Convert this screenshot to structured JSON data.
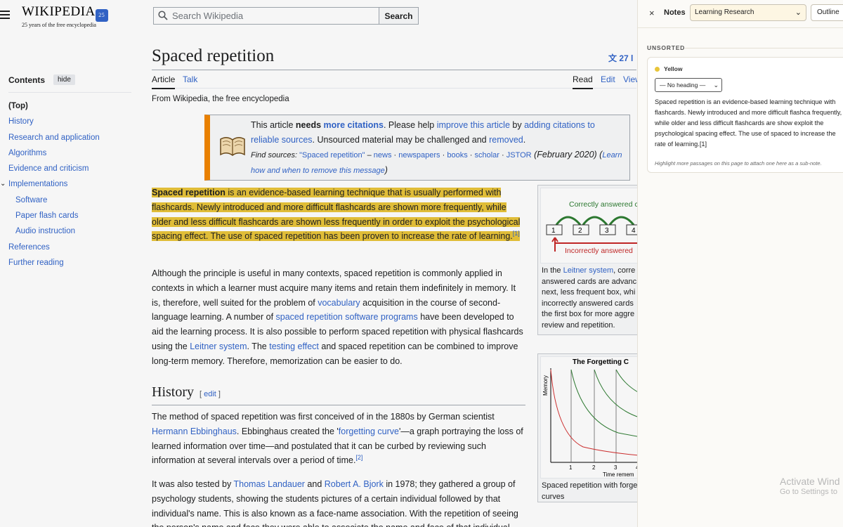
{
  "header": {
    "logo_text": "WIKIPEDIA",
    "logo_badge": "25",
    "tagline": "25 years of the free encyclopedia",
    "search_placeholder": "Search Wikipedia",
    "search_button": "Search"
  },
  "toc": {
    "title": "Contents",
    "hide": "hide",
    "items": [
      {
        "label": "(Top)"
      },
      {
        "label": "History"
      },
      {
        "label": "Research and application"
      },
      {
        "label": "Algorithms"
      },
      {
        "label": "Evidence and criticism"
      },
      {
        "label": "Implementations"
      },
      {
        "label": "Software"
      },
      {
        "label": "Paper flash cards"
      },
      {
        "label": "Audio instruction"
      },
      {
        "label": "References"
      },
      {
        "label": "Further reading"
      }
    ]
  },
  "article": {
    "title": "Spaced repetition",
    "languages": "27 l",
    "tab_article": "Article",
    "tab_talk": "Talk",
    "tab_read": "Read",
    "tab_edit": "Edit",
    "tab_view": "View",
    "from": "From Wikipedia, the free encyclopedia",
    "ambox": {
      "t1": "This article ",
      "t2": "needs ",
      "t3": "more citations",
      "t4": ". Please help ",
      "t5": "improve this article",
      "t6": " by ",
      "t7": "adding citations to reliable sources",
      "t8": ". Unsourced material may be challenged and ",
      "t9": "removed",
      "t10": ".",
      "find": "Find sources: ",
      "q": "\"Spaced repetition\"",
      "dash": " – ",
      "news": "news",
      "newspapers": "newspapers",
      "books": "books",
      "scholar": "scholar",
      "jstor": "JSTOR",
      "date": " (February 2020) (",
      "learn": "Learn how and when to remove this message",
      "close": ")"
    },
    "p1": {
      "b": "Spaced repetition",
      "t": " is an evidence-based learning technique that is usually performed with flashcards. Newly introduced and more difficult flashcards are shown more frequently, while older and less difficult flashcards are shown less frequently in order to exploit the psychological spacing effect. The use of spaced repetition has been proven to increase the rate of learning.",
      "ref": "[1]"
    },
    "p2": {
      "a": "Although the principle is useful in many contexts, spaced repetition is commonly applied in contexts in which a learner must acquire many items and retain them indefinitely in memory. It is, therefore, well suited for the problem of ",
      "l1": "vocabulary",
      "b": " acquisition in the course of second-language learning. A number of ",
      "l2": "spaced repetition software programs",
      "c": " have been developed to aid the learning process. It is also possible to perform spaced repetition with physical flashcards using the ",
      "l3": "Leitner system",
      "d": ". The ",
      "l4": "testing effect",
      "e": " and spaced repetition can be combined to improve long-term memory. Therefore, memorization can be easier to do."
    },
    "history": {
      "heading": "History",
      "edit": "edit",
      "lb": "[ ",
      "rb": " ]",
      "p1a": "The method of spaced repetition was first conceived of in the 1880s by German scientist ",
      "p1l1": "Hermann Ebbinghaus",
      "p1b": ". Ebbinghaus created the '",
      "p1l2": "forgetting curve",
      "p1c": "'—a graph portraying the loss of learned information over time—and postulated that it can be curbed by reviewing such information at several intervals over a period of time.",
      "p1ref": "[2]",
      "p2a": "It was also tested by ",
      "p2l1": "Thomas Landauer",
      "p2b": " and ",
      "p2l2": "Robert A. Bjork",
      "p2c": " in 1978; they gathered a group of psychology students, showing the students pictures of a certain individual followed by that individual's name. This is also known as a face-name association. With the repetition of seeing the person's name and face they were able to associate the name and face of that individual shown with the expan"
    },
    "leitner": {
      "top_label": "Correctly answered c",
      "bottom_label": "Incorrectly answered",
      "boxes": [
        "1",
        "2",
        "3",
        "4"
      ],
      "cap_a": "In the ",
      "cap_link": "Leitner system",
      "cap_b": ", corre answered cards are advanc next, less frequent box, whi incorrectly answered cards the first box for more aggre review and repetition."
    },
    "forgetting": {
      "title": "The Forgetting C",
      "ylabel": "Memory",
      "xlabel": "Time remem",
      "ticks": [
        "1",
        "2",
        "3",
        "4"
      ],
      "caption": "Spaced repetition with forge curves"
    }
  },
  "notes": {
    "close": "×",
    "title": "Notes",
    "collection": "Learning Research",
    "view_mode": "Outline",
    "group": "UNSORTED",
    "card": {
      "color_label": "Yellow",
      "color": "#e8c53a",
      "heading_select": "— No heading —",
      "text": "Spaced repetition is an evidence-based learning technique with flashcards. Newly introduced and more difficult flashca frequently, while older and less difficult flashcards are show exploit the psychological spacing effect. The use of spaced to increase the rate of learning.[1]",
      "hint": "Highlight more passages on this page to attach one here as a sub-note."
    }
  },
  "os": {
    "activate_title": "Activate Wind",
    "activate_sub": "Go to Settings to"
  },
  "colors": {
    "link": "#3366cc",
    "highlight": "#e9c43b",
    "ambox_border": "#f28500",
    "correct": "#2e7d32",
    "incorrect": "#c62828"
  }
}
